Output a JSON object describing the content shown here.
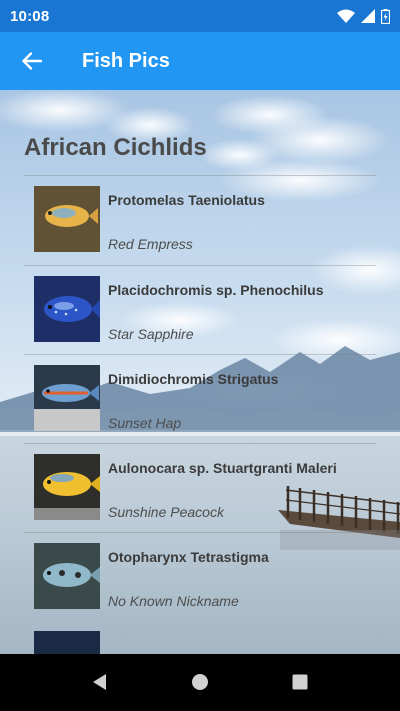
{
  "status_bar": {
    "time": "10:08"
  },
  "app_bar": {
    "title": "Fish Pics"
  },
  "section": {
    "title": "African Cichlids"
  },
  "fish": [
    {
      "name": "Protomelas Taeniolatus",
      "nickname": "Red Empress",
      "color": "#e7b44a"
    },
    {
      "name": "Placidochromis sp. Phenochilus",
      "nickname": "Star Sapphire",
      "color": "#2c55c8"
    },
    {
      "name": "Dimidiochromis Strigatus",
      "nickname": "Sunset Hap",
      "color": "#6f9fd0"
    },
    {
      "name": "Aulonocara sp. Stuartgranti Maleri",
      "nickname": "Sunshine Peacock",
      "color": "#f0c030"
    },
    {
      "name": "Otopharynx Tetrastigma",
      "nickname": "No Known Nickname",
      "color": "#8fb8c8"
    }
  ],
  "colors": {
    "status_bar": "#1976d2",
    "app_bar": "#2196f3",
    "nav_bar": "#000000"
  },
  "icons": {
    "back": "arrow-left-icon",
    "wifi": "wifi-icon",
    "signal": "signal-icon",
    "battery": "battery-icon",
    "nav_back": "triangle-back-icon",
    "nav_home": "circle-home-icon",
    "nav_recents": "square-recents-icon"
  }
}
